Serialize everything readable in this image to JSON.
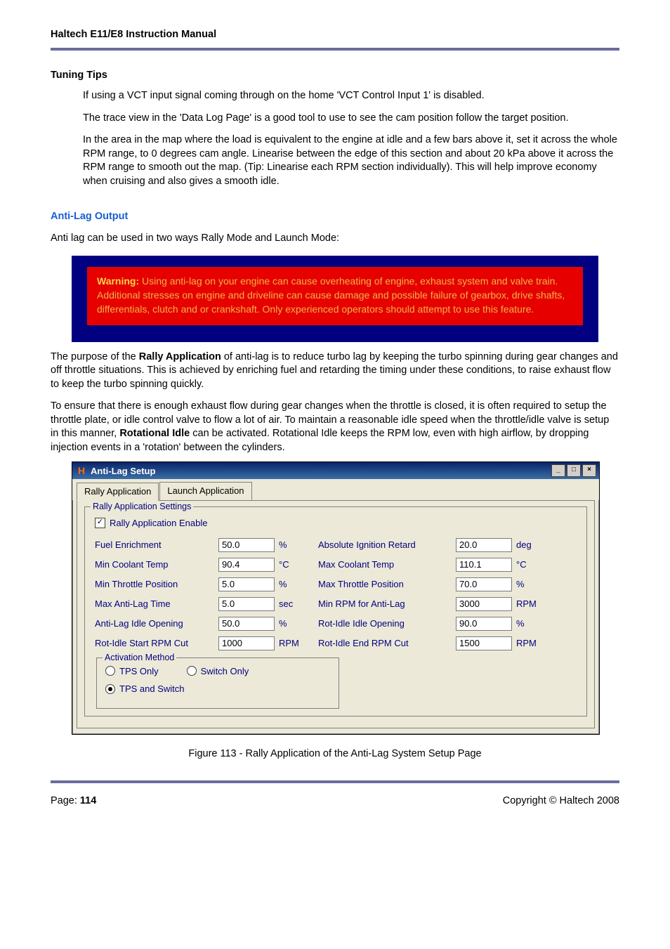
{
  "header": {
    "title": "Haltech E11/E8 Instruction Manual"
  },
  "tuning": {
    "heading": "Tuning Tips",
    "p1": "If using a VCT input signal coming through on the home 'VCT Control Input 1' is disabled.",
    "p2": "The trace view in the 'Data Log Page' is a good tool to use to see the cam position follow the target position.",
    "p3": "In the area in the map where the load is equivalent to the engine at idle and a few bars above it, set it across the whole RPM range, to 0 degrees cam angle. Linearise between the edge of this section and about 20 kPa above it across the RPM range to smooth out the map. (Tip: Linearise each RPM section individually). This will help improve economy when cruising and also gives a smooth idle."
  },
  "antilag": {
    "heading": "Anti-Lag Output",
    "intro": "Anti lag can be used in two ways Rally Mode and Launch Mode:",
    "warning_label": "Warning:",
    "warning_body": " Using anti-lag on your engine can cause overheating of engine, exhaust system and valve train. Additional stresses on engine and driveline can cause damage and possible failure of gearbox, drive shafts, differentials, clutch and or crankshaft. Only experienced operators should attempt to use this feature.",
    "p_rally_pre": "The purpose of the ",
    "p_rally_bold": "Rally Application",
    "p_rally_post": " of anti-lag is to reduce turbo lag by keeping the turbo spinning during gear changes and off throttle situations. This is achieved by enriching fuel and retarding the timing under these conditions, to raise exhaust flow to keep the turbo spinning quickly.",
    "p_rot_pre": "To ensure that there is enough exhaust flow during gear changes when the throttle is closed, it is often required to setup the throttle plate, or idle control valve to flow a lot of air. To maintain a reasonable idle speed when the throttle/idle valve is setup in this manner, ",
    "p_rot_bold": "Rotational Idle",
    "p_rot_post": " can be activated. Rotational Idle keeps the RPM low, even with high airflow, by dropping injection events in a 'rotation' between the cylinders."
  },
  "win": {
    "title": "Anti-Lag Setup",
    "tabs": {
      "rally": "Rally Application",
      "launch": "Launch Application"
    },
    "group_legend": "Rally Application Settings",
    "enable_label": "Rally Application Enable",
    "labels": {
      "fuel": "Fuel Enrichment",
      "abs_ign": "Absolute Ignition Retard",
      "min_cool": "Min Coolant Temp",
      "max_cool": "Max Coolant Temp",
      "min_thr": "Min Throttle Position",
      "max_thr": "Max Throttle Position",
      "max_time": "Max Anti-Lag Time",
      "min_rpm": "Min RPM for Anti-Lag",
      "al_idle": "Anti-Lag Idle Opening",
      "rot_idle": "Rot-Idle Idle Opening",
      "rot_start": "Rot-Idle Start RPM Cut",
      "rot_end": "Rot-Idle End RPM Cut"
    },
    "values": {
      "fuel": "50.0",
      "abs_ign": "20.0",
      "min_cool": "90.4",
      "max_cool": "110.1",
      "min_thr": "5.0",
      "max_thr": "70.0",
      "max_time": "5.0",
      "min_rpm": "3000",
      "al_idle": "50.0",
      "rot_idle": "90.0",
      "rot_start": "1000",
      "rot_end": "1500"
    },
    "units": {
      "pct": "%",
      "deg": "deg",
      "c": "°C",
      "sec": "sec",
      "rpm": "RPM"
    },
    "activation": {
      "legend": "Activation Method",
      "tps": "TPS Only",
      "switch": "Switch Only",
      "both": "TPS and Switch"
    }
  },
  "caption": "Figure 113 - Rally Application of the Anti-Lag System Setup Page",
  "footer": {
    "page_label": "Page: ",
    "page_no": "114",
    "copyright": "Copyright © Haltech 2008"
  }
}
